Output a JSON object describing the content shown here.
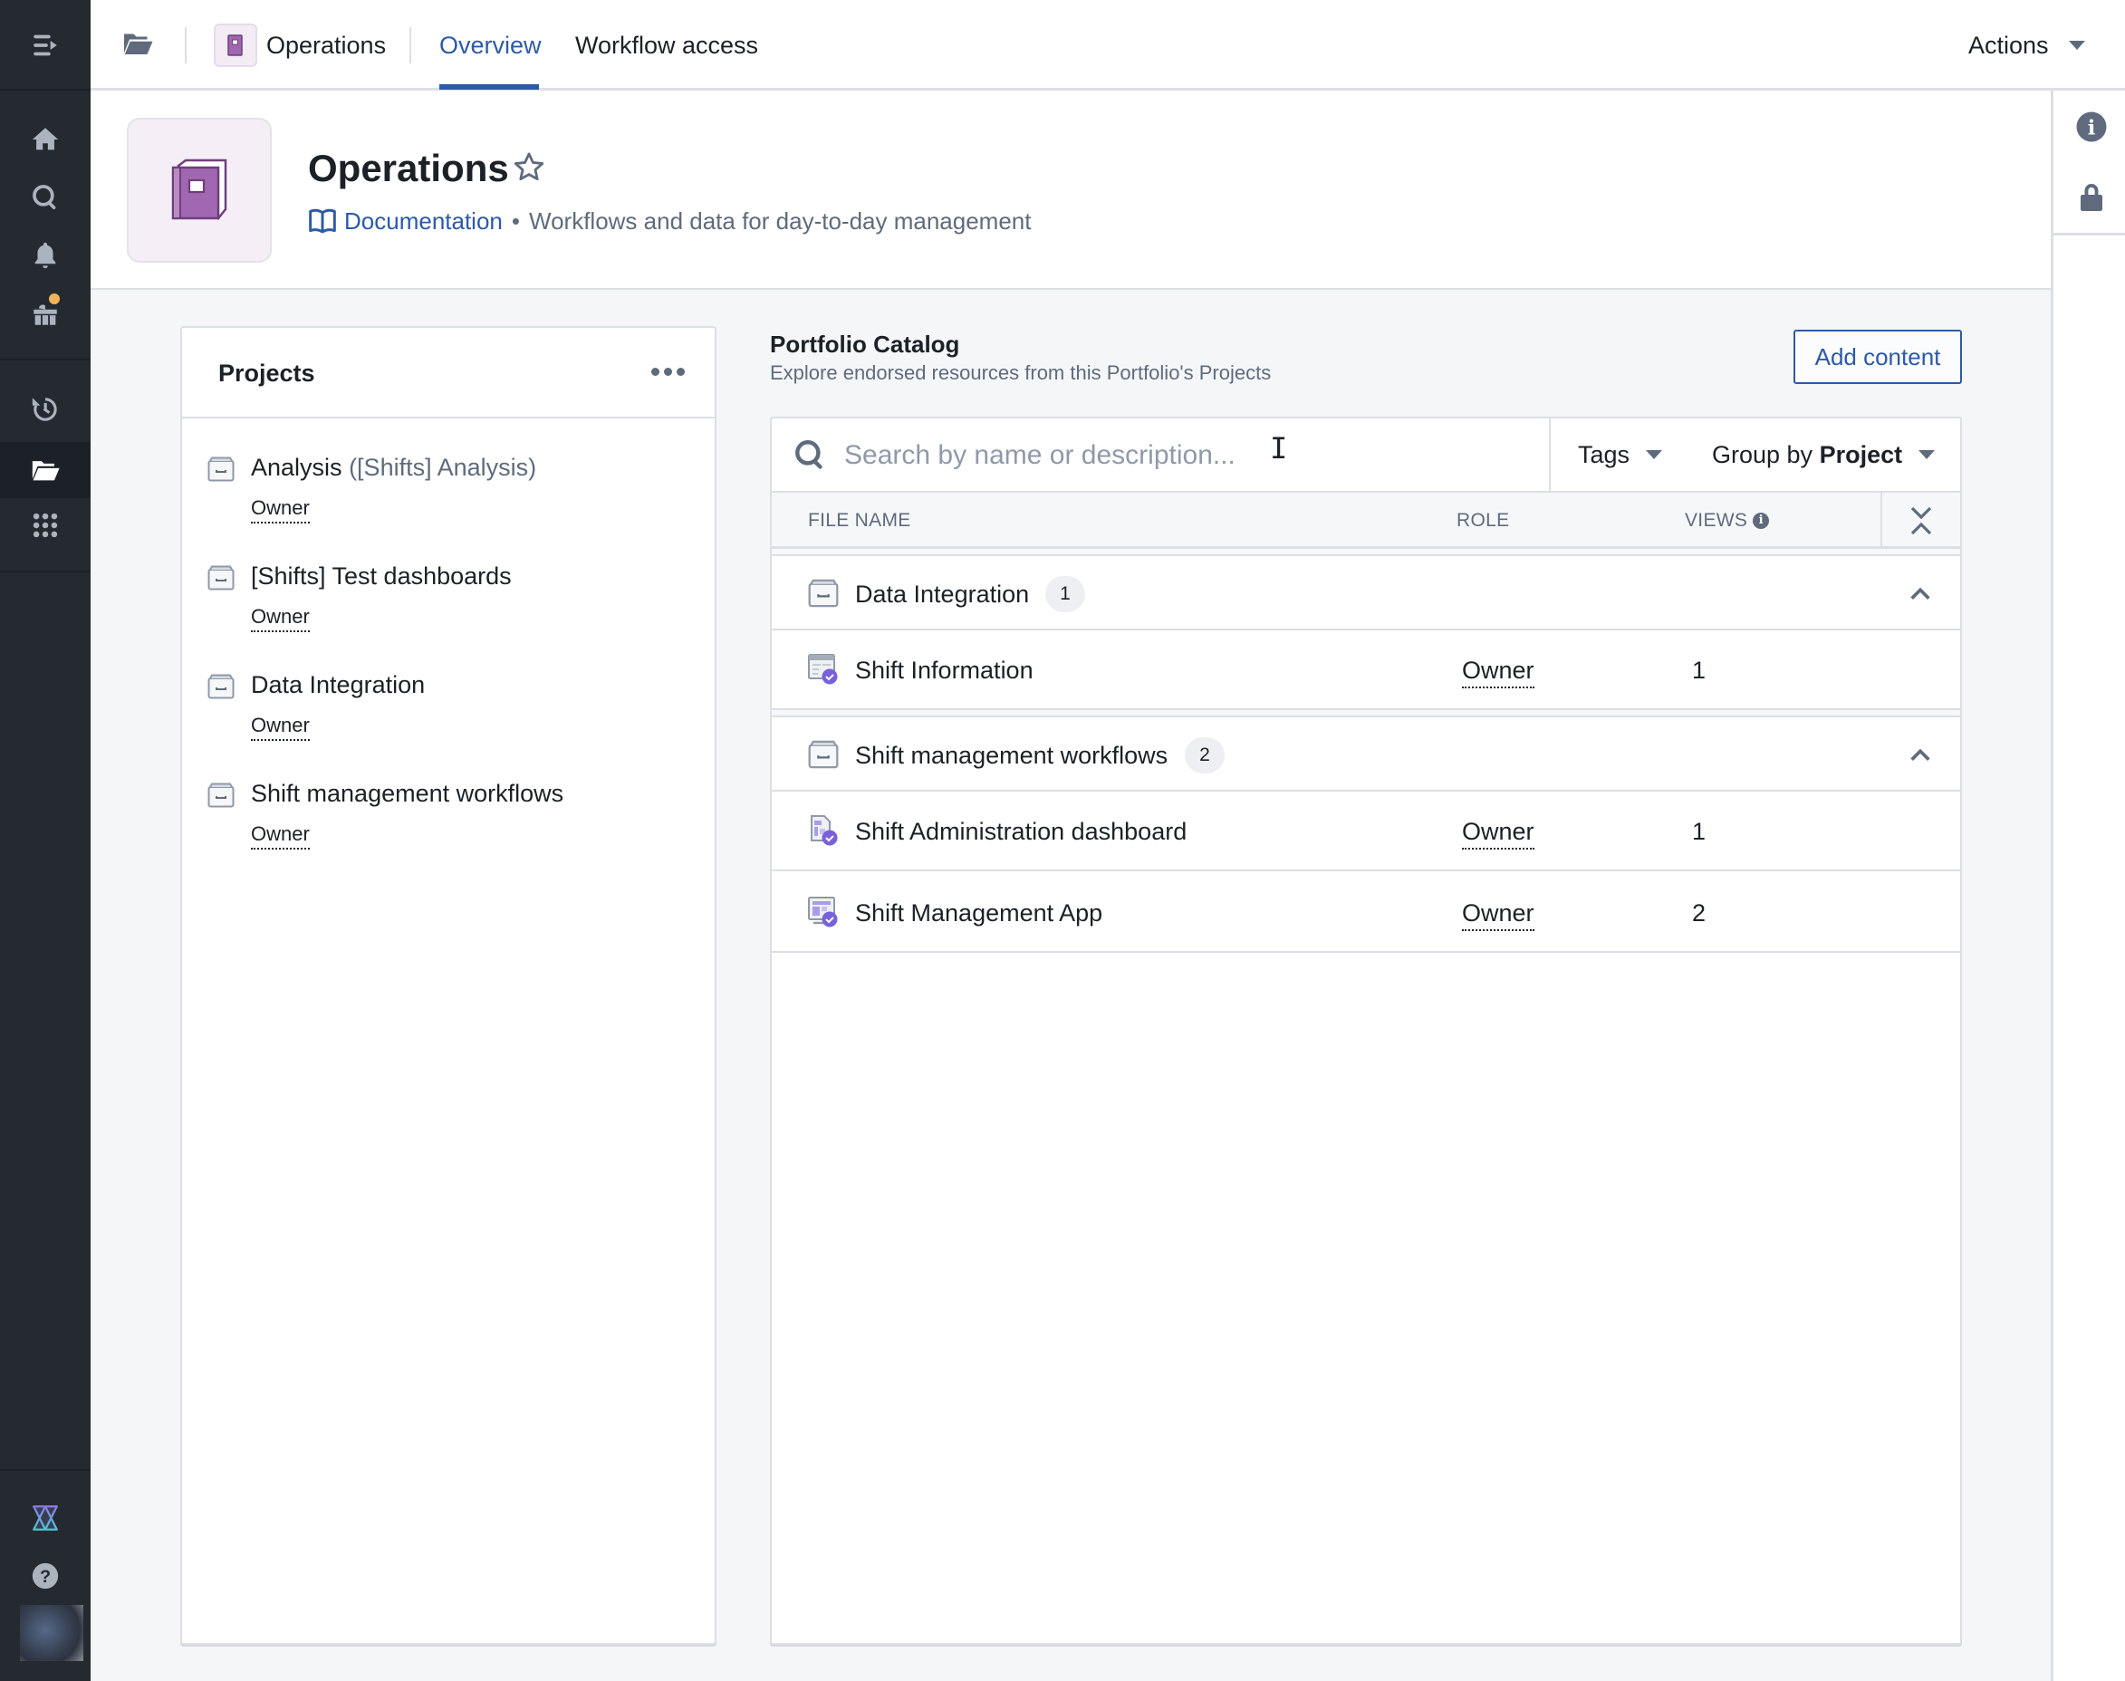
{
  "sidebar": {
    "items": [
      {
        "name": "menu-toggle",
        "icon": "collapse-menu-icon"
      },
      {
        "name": "home",
        "icon": "home-icon"
      },
      {
        "name": "search",
        "icon": "search-icon"
      },
      {
        "name": "notifications",
        "icon": "bell-icon"
      },
      {
        "name": "whats-new",
        "icon": "gift-icon",
        "badge": true
      },
      {
        "name": "recent",
        "icon": "history-icon"
      },
      {
        "name": "files",
        "icon": "folder-open-icon",
        "active": true
      },
      {
        "name": "apps",
        "icon": "apps-grid-icon"
      },
      {
        "name": "platform",
        "icon": "platform-logo-icon"
      },
      {
        "name": "help",
        "icon": "help-icon"
      },
      {
        "name": "account",
        "icon": "avatar"
      }
    ],
    "badge_color": "#f0b35b"
  },
  "topnav": {
    "breadcrumb_label": "Operations",
    "tabs": [
      {
        "label": "Overview",
        "active": true
      },
      {
        "label": "Workflow access",
        "active": false
      }
    ],
    "actions_label": "Actions"
  },
  "header": {
    "title": "Operations",
    "doc_link": "Documentation",
    "separator": "•",
    "description": "Workflows and data for day-to-day management"
  },
  "projects": {
    "title": "Projects",
    "items": [
      {
        "name": "Analysis",
        "alias": "([Shifts] Analysis)",
        "role": "Owner"
      },
      {
        "name": "[Shifts] Test dashboards",
        "alias": "",
        "role": "Owner"
      },
      {
        "name": "Data Integration",
        "alias": "",
        "role": "Owner"
      },
      {
        "name": "Shift management workflows",
        "alias": "",
        "role": "Owner"
      }
    ]
  },
  "catalog": {
    "title": "Portfolio Catalog",
    "subtitle": "Explore endorsed resources from this Portfolio's Projects",
    "add_button": "Add content",
    "search": {
      "placeholder": "Search by name or description...",
      "value": ""
    },
    "tags_label": "Tags",
    "group_by_prefix": "Group by",
    "group_by_value": "Project",
    "columns": {
      "file_name": "FILE NAME",
      "role": "ROLE",
      "views": "VIEWS"
    },
    "groups": [
      {
        "name": "Data Integration",
        "count": "1",
        "expanded": true,
        "files": [
          {
            "name": "Shift Information",
            "type": "dataset",
            "role": "Owner",
            "views": "1"
          }
        ]
      },
      {
        "name": "Shift management workflows",
        "count": "2",
        "expanded": true,
        "files": [
          {
            "name": "Shift Administration dashboard",
            "type": "dashboard",
            "role": "Owner",
            "views": "1"
          },
          {
            "name": "Shift Management App",
            "type": "app",
            "role": "Owner",
            "views": "2"
          }
        ]
      }
    ]
  },
  "colors": {
    "accent": "#2d5aa8",
    "sidebar_bg": "#252a31",
    "portfolio_purple": "#9b5ea8",
    "endorsed_badge": "#7961db"
  }
}
